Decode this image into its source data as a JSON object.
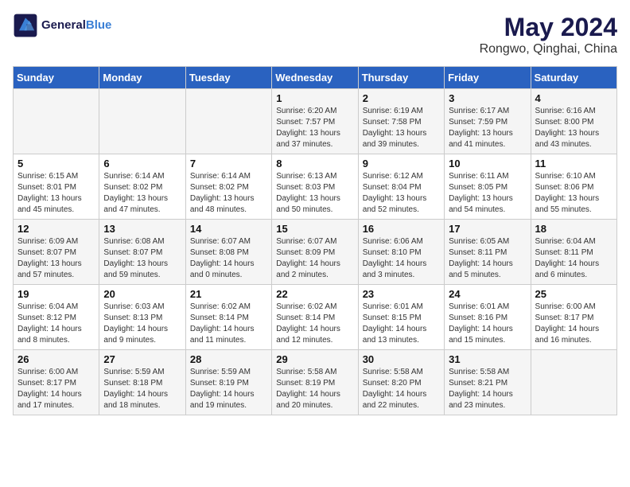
{
  "header": {
    "logo_line1": "General",
    "logo_line2": "Blue",
    "month": "May 2024",
    "location": "Rongwo, Qinghai, China"
  },
  "weekdays": [
    "Sunday",
    "Monday",
    "Tuesday",
    "Wednesday",
    "Thursday",
    "Friday",
    "Saturday"
  ],
  "weeks": [
    [
      {
        "day": "",
        "info": ""
      },
      {
        "day": "",
        "info": ""
      },
      {
        "day": "",
        "info": ""
      },
      {
        "day": "1",
        "info": "Sunrise: 6:20 AM\nSunset: 7:57 PM\nDaylight: 13 hours\nand 37 minutes."
      },
      {
        "day": "2",
        "info": "Sunrise: 6:19 AM\nSunset: 7:58 PM\nDaylight: 13 hours\nand 39 minutes."
      },
      {
        "day": "3",
        "info": "Sunrise: 6:17 AM\nSunset: 7:59 PM\nDaylight: 13 hours\nand 41 minutes."
      },
      {
        "day": "4",
        "info": "Sunrise: 6:16 AM\nSunset: 8:00 PM\nDaylight: 13 hours\nand 43 minutes."
      }
    ],
    [
      {
        "day": "5",
        "info": "Sunrise: 6:15 AM\nSunset: 8:01 PM\nDaylight: 13 hours\nand 45 minutes."
      },
      {
        "day": "6",
        "info": "Sunrise: 6:14 AM\nSunset: 8:02 PM\nDaylight: 13 hours\nand 47 minutes."
      },
      {
        "day": "7",
        "info": "Sunrise: 6:14 AM\nSunset: 8:02 PM\nDaylight: 13 hours\nand 48 minutes."
      },
      {
        "day": "8",
        "info": "Sunrise: 6:13 AM\nSunset: 8:03 PM\nDaylight: 13 hours\nand 50 minutes."
      },
      {
        "day": "9",
        "info": "Sunrise: 6:12 AM\nSunset: 8:04 PM\nDaylight: 13 hours\nand 52 minutes."
      },
      {
        "day": "10",
        "info": "Sunrise: 6:11 AM\nSunset: 8:05 PM\nDaylight: 13 hours\nand 54 minutes."
      },
      {
        "day": "11",
        "info": "Sunrise: 6:10 AM\nSunset: 8:06 PM\nDaylight: 13 hours\nand 55 minutes."
      }
    ],
    [
      {
        "day": "12",
        "info": "Sunrise: 6:09 AM\nSunset: 8:07 PM\nDaylight: 13 hours\nand 57 minutes."
      },
      {
        "day": "13",
        "info": "Sunrise: 6:08 AM\nSunset: 8:07 PM\nDaylight: 13 hours\nand 59 minutes."
      },
      {
        "day": "14",
        "info": "Sunrise: 6:07 AM\nSunset: 8:08 PM\nDaylight: 14 hours\nand 0 minutes."
      },
      {
        "day": "15",
        "info": "Sunrise: 6:07 AM\nSunset: 8:09 PM\nDaylight: 14 hours\nand 2 minutes."
      },
      {
        "day": "16",
        "info": "Sunrise: 6:06 AM\nSunset: 8:10 PM\nDaylight: 14 hours\nand 3 minutes."
      },
      {
        "day": "17",
        "info": "Sunrise: 6:05 AM\nSunset: 8:11 PM\nDaylight: 14 hours\nand 5 minutes."
      },
      {
        "day": "18",
        "info": "Sunrise: 6:04 AM\nSunset: 8:11 PM\nDaylight: 14 hours\nand 6 minutes."
      }
    ],
    [
      {
        "day": "19",
        "info": "Sunrise: 6:04 AM\nSunset: 8:12 PM\nDaylight: 14 hours\nand 8 minutes."
      },
      {
        "day": "20",
        "info": "Sunrise: 6:03 AM\nSunset: 8:13 PM\nDaylight: 14 hours\nand 9 minutes."
      },
      {
        "day": "21",
        "info": "Sunrise: 6:02 AM\nSunset: 8:14 PM\nDaylight: 14 hours\nand 11 minutes."
      },
      {
        "day": "22",
        "info": "Sunrise: 6:02 AM\nSunset: 8:14 PM\nDaylight: 14 hours\nand 12 minutes."
      },
      {
        "day": "23",
        "info": "Sunrise: 6:01 AM\nSunset: 8:15 PM\nDaylight: 14 hours\nand 13 minutes."
      },
      {
        "day": "24",
        "info": "Sunrise: 6:01 AM\nSunset: 8:16 PM\nDaylight: 14 hours\nand 15 minutes."
      },
      {
        "day": "25",
        "info": "Sunrise: 6:00 AM\nSunset: 8:17 PM\nDaylight: 14 hours\nand 16 minutes."
      }
    ],
    [
      {
        "day": "26",
        "info": "Sunrise: 6:00 AM\nSunset: 8:17 PM\nDaylight: 14 hours\nand 17 minutes."
      },
      {
        "day": "27",
        "info": "Sunrise: 5:59 AM\nSunset: 8:18 PM\nDaylight: 14 hours\nand 18 minutes."
      },
      {
        "day": "28",
        "info": "Sunrise: 5:59 AM\nSunset: 8:19 PM\nDaylight: 14 hours\nand 19 minutes."
      },
      {
        "day": "29",
        "info": "Sunrise: 5:58 AM\nSunset: 8:19 PM\nDaylight: 14 hours\nand 20 minutes."
      },
      {
        "day": "30",
        "info": "Sunrise: 5:58 AM\nSunset: 8:20 PM\nDaylight: 14 hours\nand 22 minutes."
      },
      {
        "day": "31",
        "info": "Sunrise: 5:58 AM\nSunset: 8:21 PM\nDaylight: 14 hours\nand 23 minutes."
      },
      {
        "day": "",
        "info": ""
      }
    ]
  ]
}
